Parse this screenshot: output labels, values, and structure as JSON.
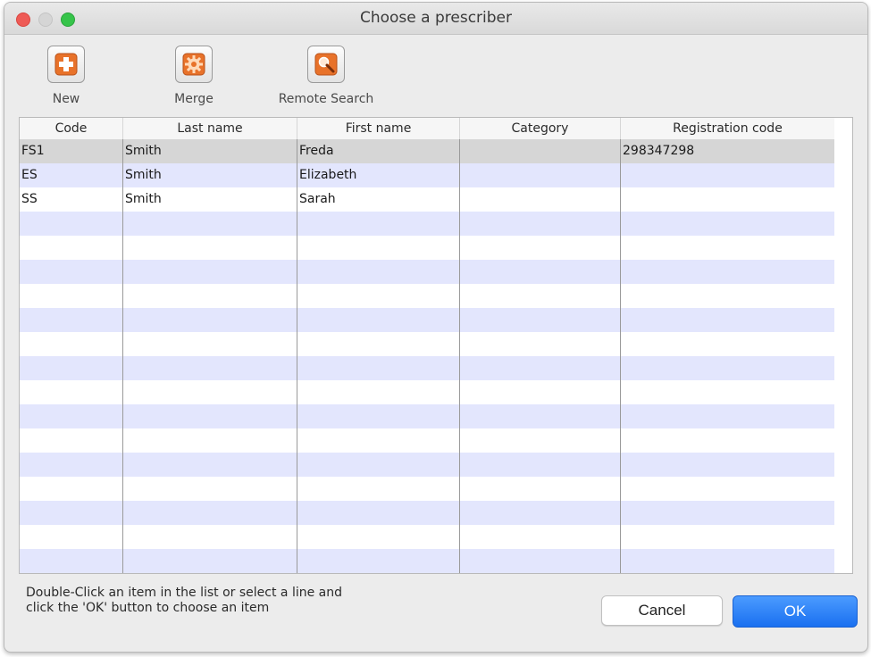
{
  "window": {
    "title": "Choose a prescriber"
  },
  "toolbar": {
    "new_label": "New",
    "merge_label": "Merge",
    "remote_search_label": "Remote Search"
  },
  "table": {
    "columns": [
      "Code",
      "Last name",
      "First name",
      "Category",
      "Registration code"
    ],
    "rows": [
      [
        "FS1",
        "Smith",
        "Freda",
        "",
        "298347298"
      ],
      [
        "ES",
        "Smith",
        "Elizabeth",
        "",
        ""
      ],
      [
        "SS",
        "Smith",
        "Sarah",
        "",
        ""
      ]
    ],
    "selected_row": 0
  },
  "footer": {
    "hint_line1": "Double-Click an item in the list or select a line and",
    "hint_line2": "click the 'OK' button to choose an item",
    "cancel_label": "Cancel",
    "ok_label": "OK"
  },
  "colors": {
    "accent": "#1a70f0",
    "row_stripe": "#e3e6fd",
    "selected_row": "#d6d6d6",
    "icon_orange": "#e8722a"
  },
  "icons": {
    "new": "plus-icon",
    "merge": "gear-icon",
    "remote_search": "magnifier-icon"
  }
}
